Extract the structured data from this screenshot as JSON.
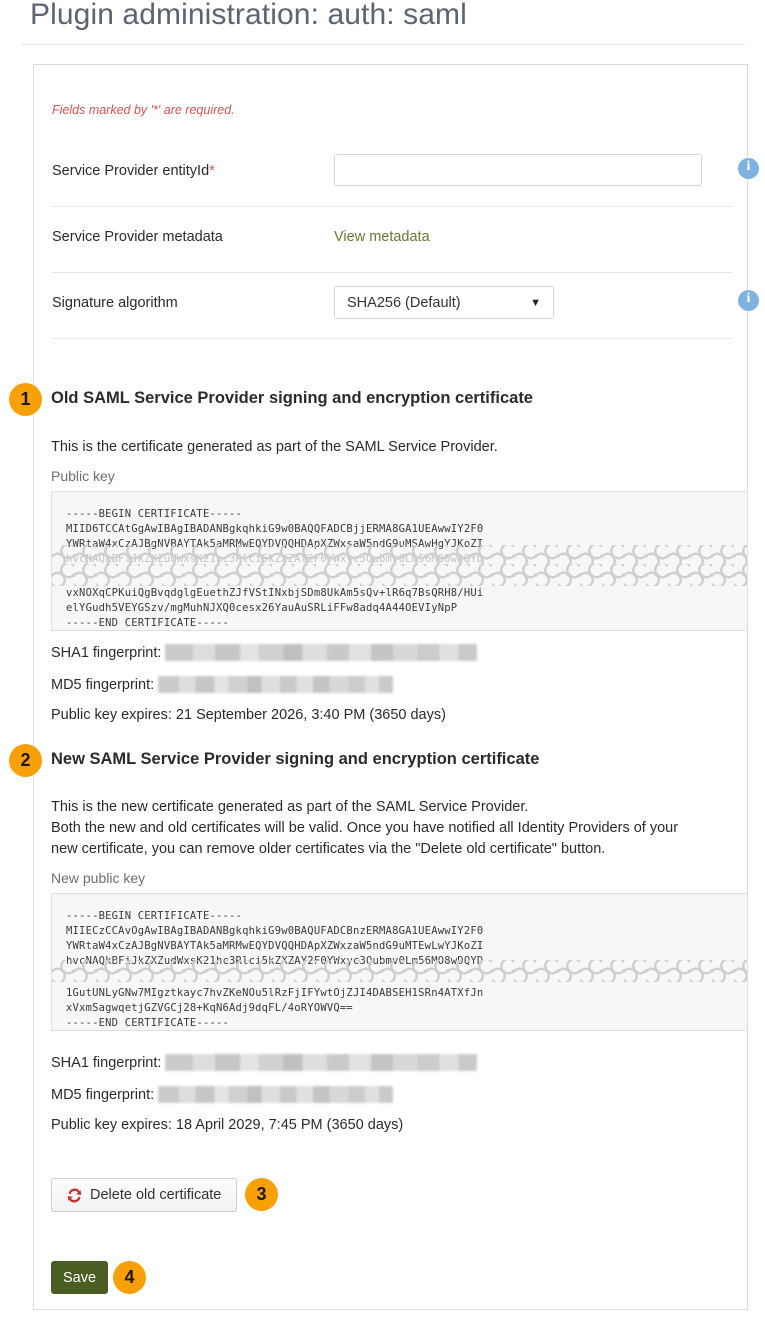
{
  "page": {
    "title": "Plugin administration: auth: saml"
  },
  "form": {
    "required_note": "Fields marked by '*' are required.",
    "rows": [
      {
        "label": "Service Provider entityId",
        "required_marker": "*",
        "value": "",
        "placeholder": "",
        "info_icon": "info-icon"
      },
      {
        "label": "Service Provider metadata",
        "link_text": "View metadata"
      },
      {
        "label": "Signature algorithm",
        "selected_option": "SHA256 (Default)",
        "caret_icon": "chevron-down-icon",
        "info_icon": "info-icon"
      }
    ]
  },
  "sections": [
    {
      "badge": "1",
      "heading": "Old SAML Service Provider signing and encryption certificate",
      "description": "This is the certificate generated as part of the SAML Service Provider.",
      "key_label": "Public key",
      "cert_lines_top": [
        "-----BEGIN CERTIFICATE-----",
        "MIID6TCCAtGgAwIBAgIBADANBgkqhkiG9w0BAQQFADCBjjERMA8GA1UEAwwIY2F0",
        "YWRtaW4xCzAJBgNVBAYTAk5aMRMwEQYDVQQHDApXZWxsaW5ndG9uMSAwHgYJKoZI"
      ],
      "cert_lines_bottom": [
        "vxNOXqCPKuiQgBvqdglgEuethZJfVStINxbjSDm8UkAm5sQv+lR6q7BsQRH8/HUi",
        "elYGudh5VEYGSzv/mgMuhNJXQ0cesx26YauAuSRLiFFw8adq4A44OEVIyNpP",
        "-----END CERTIFICATE-----"
      ],
      "sha1_label": "SHA1 fingerprint:",
      "sha1_value": "",
      "md5_label": "MD5 fingerprint:",
      "md5_value": "",
      "expiry": "Public key expires: 21 September 2026, 3:40 PM (3650 days)"
    },
    {
      "badge": "2",
      "heading": "New SAML Service Provider signing and encryption certificate",
      "description_line_1": "This is the new certificate generated as part of the SAML Service Provider.",
      "description_line_2": "Both the new and old certificates will be valid. Once you have notified all Identity Providers of your",
      "description_line_3": "new certificate, you can remove older certificates via the \"Delete old certificate\" button.",
      "key_label": "New public key",
      "cert_lines_top": [
        "-----BEGIN CERTIFICATE-----",
        "MIIECzCCAvOgAwIBAgIBADANBgkqhkiG9w0BAQUFADCBnzERMA8GA1UEAwwIY2F0",
        "YWRtaW4xCzAJBgNVBAYTAk5aMRMwEQYDVQQHDApXZWxzaW5ndG9uMTEwLwYJKoZI",
        "hvcNAQkBFiJkZXZudWxsK21hc3Rlci5kZXZAY2F0YWxyc3Qubmv0Lm56MO8wDQYD"
      ],
      "cert_lines_bottom": [
        "1GutUNLyGNw7MIgztkayc7hvZKeNOu5lRzFjIFYwtOjZJI4DABSEH1SRn4ATXfJn",
        "xVxmSagwqetjGZVGCj28+KqN6Adj9dqFL/4oRYOWVQ==",
        "-----END CERTIFICATE-----"
      ],
      "sha1_label": "SHA1 fingerprint:",
      "sha1_value": "",
      "md5_label": "MD5 fingerprint:",
      "md5_value": "",
      "expiry": "Public key expires: 18 April 2029, 7:45 PM (3650 days)"
    }
  ],
  "actions": {
    "delete_badge": "3",
    "delete_label": "Delete old certificate",
    "delete_icon": "refresh-icon",
    "save_badge": "4",
    "save_label": "Save"
  },
  "colors": {
    "badge": "#F9A007",
    "link": "#6A7A32",
    "required": "#D9534F",
    "save_button": "#4A5D23",
    "info_icon": "#7FB2E0",
    "delete_icon": "#C9302C"
  }
}
